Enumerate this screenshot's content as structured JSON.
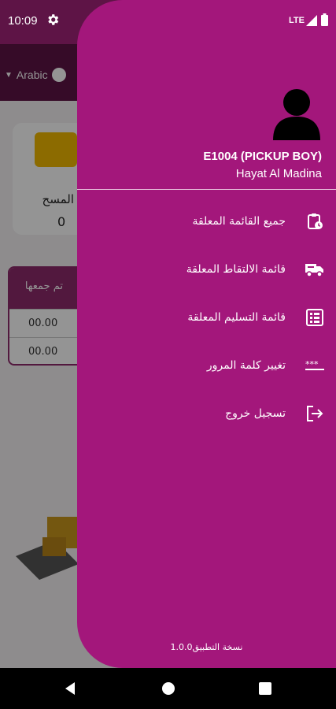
{
  "status_bar": {
    "time": "10:09",
    "network": "LTE"
  },
  "background": {
    "language": "Arabic",
    "card_label": "المسح",
    "card_value": "0",
    "table_header": "تم جمعها",
    "table_rows": [
      "00.00",
      "00.00"
    ]
  },
  "drawer": {
    "user_id": "E1004 (PICKUP BOY)",
    "branch": "Hayat Al Madina",
    "menu": [
      {
        "label": "جميع القائمة المعلقة",
        "icon": "clipboard-clock-icon"
      },
      {
        "label": "قائمة الالتقاط المعلقة",
        "icon": "truck-icon"
      },
      {
        "label": "قائمة التسليم المعلقة",
        "icon": "list-icon"
      },
      {
        "label": "تغيير كلمة المرور",
        "icon": "password-icon"
      },
      {
        "label": "تسجيل خروج",
        "icon": "logout-icon"
      }
    ],
    "version": "نسخة التطبيق1.0.0"
  },
  "colors": {
    "drawer": "#a3177b",
    "header": "#5e1446"
  }
}
